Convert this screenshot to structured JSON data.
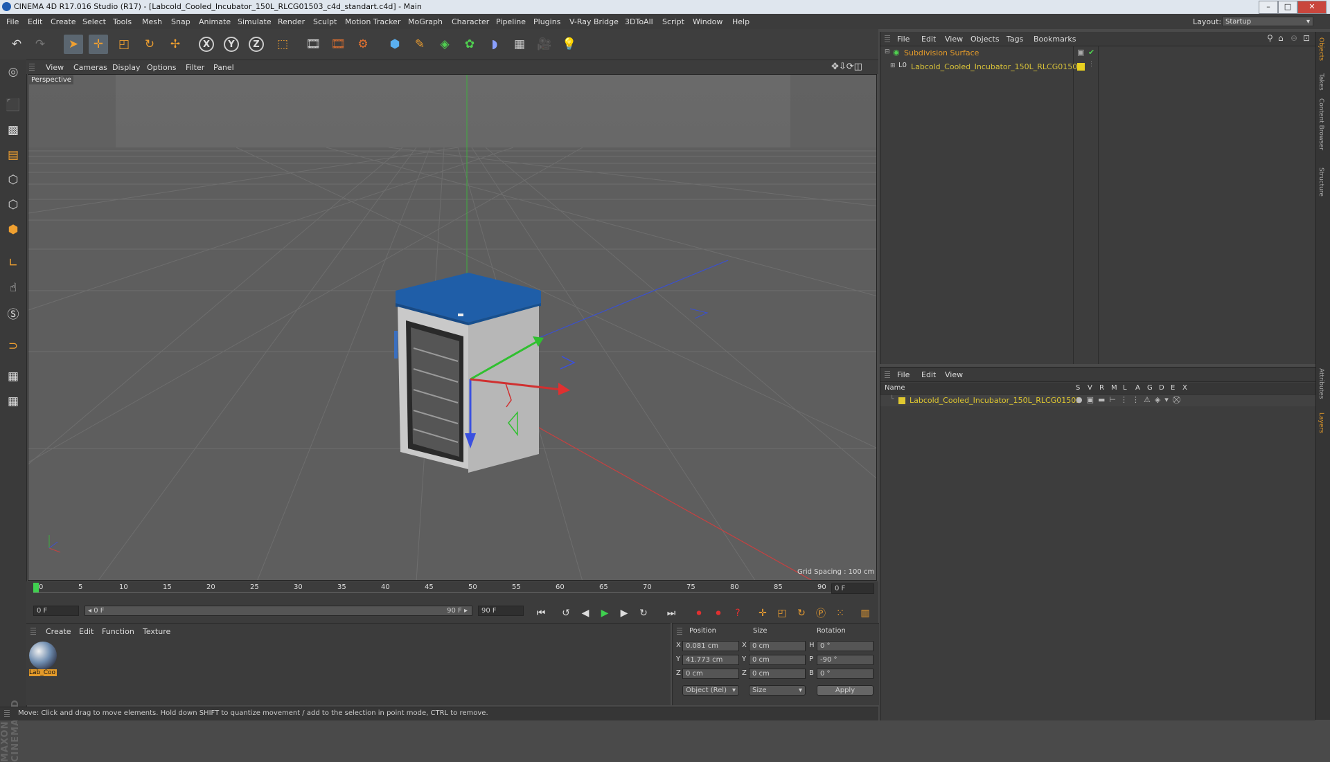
{
  "window": {
    "title": "CINEMA 4D R17.016 Studio (R17) - [Labcold_Cooled_Incubator_150L_RLCG01503_c4d_standart.c4d] - Main",
    "controls": [
      "–",
      "□",
      "✕"
    ]
  },
  "menubar": {
    "items": [
      "File",
      "Edit",
      "Create",
      "Select",
      "Tools",
      "Mesh",
      "Snap",
      "Animate",
      "Simulate",
      "Render",
      "Sculpt",
      "Motion Tracker",
      "MoGraph",
      "Character",
      "Pipeline",
      "Plugins",
      "V-Ray Bridge",
      "3DToAll",
      "Script",
      "Window",
      "Help"
    ],
    "layout_label": "Layout:",
    "layout_value": "Startup"
  },
  "toolbar": {
    "icons": [
      "undo-icon",
      "redo-icon",
      "select-arrow-icon",
      "move-icon",
      "scale-icon",
      "rotate-icon",
      "live-selection-icon",
      "x-axis-icon",
      "y-axis-icon",
      "z-axis-icon",
      "coordinate-system-icon",
      "render-view-icon",
      "render-picture-viewer-icon",
      "edit-render-settings-icon",
      "cube-icon",
      "pen-spline-icon",
      "subdivision-surface-icon",
      "array-icon",
      "deformer-icon",
      "floor-icon",
      "camera-icon",
      "light-icon"
    ],
    "axis_labels": [
      "X",
      "Y",
      "Z"
    ]
  },
  "viewport": {
    "menu": [
      "View",
      "Cameras",
      "Display",
      "Options",
      "Filter",
      "Panel"
    ],
    "label": "Perspective",
    "grid_spacing": "Grid Spacing : 100 cm"
  },
  "timeline": {
    "ticks": [
      "0",
      "5",
      "10",
      "15",
      "20",
      "25",
      "30",
      "35",
      "40",
      "45",
      "50",
      "55",
      "60",
      "65",
      "70",
      "75",
      "80",
      "85",
      "90"
    ],
    "current_frame": "0 F",
    "start_field": "0 F",
    "range_start": "◂ 0 F",
    "range_end": "90 F ▸",
    "end_field": "90 F"
  },
  "material_manager": {
    "menu": [
      "Create",
      "Edit",
      "Function",
      "Texture"
    ],
    "material_name": "Lab_Coo"
  },
  "coordinates": {
    "headers": [
      "Position",
      "Size",
      "Rotation"
    ],
    "rows": [
      {
        "axis": "X",
        "pos": "0.081 cm",
        "size_axis": "X",
        "size": "0 cm",
        "rot_axis": "H",
        "rot": "0 °"
      },
      {
        "axis": "Y",
        "pos": "41.773 cm",
        "size_axis": "Y",
        "size": "0 cm",
        "rot_axis": "P",
        "rot": "-90 °"
      },
      {
        "axis": "Z",
        "pos": "0 cm",
        "size_axis": "Z",
        "size": "0 cm",
        "rot_axis": "B",
        "rot": "0 °"
      }
    ],
    "mode_dropdown": "Object (Rel)",
    "size_dropdown": "Size",
    "apply_label": "Apply"
  },
  "status": {
    "text": "Move: Click and drag to move elements. Hold down SHIFT to quantize movement / add to the selection in point mode, CTRL to remove."
  },
  "object_manager": {
    "menu": [
      "File",
      "Edit",
      "View",
      "Objects",
      "Tags",
      "Bookmarks"
    ],
    "objects": [
      {
        "name": "Subdivision Surface",
        "color": "#e39a2a"
      },
      {
        "name": "Labcold_Cooled_Incubator_150L_RLCG01503",
        "color": "#d8c23a"
      }
    ]
  },
  "layer_manager": {
    "menu": [
      "File",
      "Edit",
      "View"
    ],
    "name_header": "Name",
    "flag_headers": [
      "S",
      "V",
      "R",
      "M",
      "L",
      "A",
      "G",
      "D",
      "E",
      "X"
    ],
    "layers": [
      {
        "name": "Labcold_Cooled_Incubator_150L_RLCG01503",
        "color": "#e0c830"
      }
    ]
  },
  "side_tabs": [
    "Objects",
    "Takes",
    "Content Browser",
    "Structure",
    "Attributes",
    "Layers"
  ],
  "brand": "MAXON CINEMA 4D",
  "colors": {
    "accent_orange": "#e39a2a",
    "object_yellow": "#d8c23a",
    "x_axis": "#d03030",
    "y_axis": "#30c030",
    "z_axis": "#3050e0"
  }
}
